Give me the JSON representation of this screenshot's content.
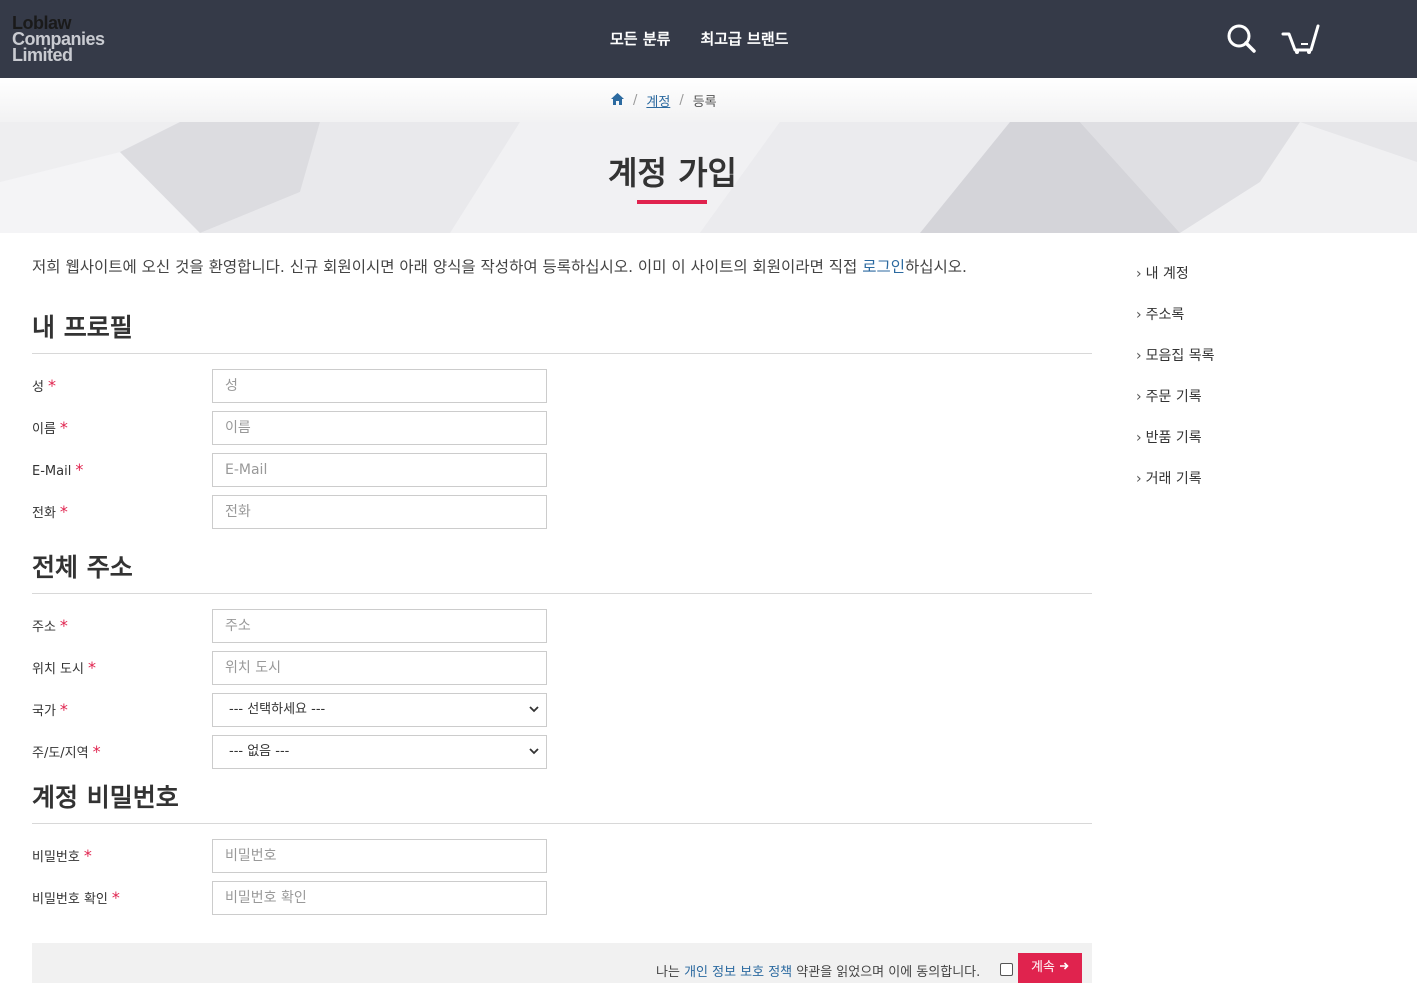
{
  "header": {
    "logo": {
      "line1": "Loblaw",
      "line2": "Companies",
      "line3": "Limited"
    },
    "nav": [
      "모든 분류",
      "최고급 브랜드"
    ]
  },
  "breadcrumb": {
    "account": "계정",
    "current": "등록"
  },
  "banner": {
    "title": "계정 가입"
  },
  "intro": {
    "before": "저희 웹사이트에 오신 것을 환영합니다. 신규 회원이시면 아래 양식을 작성하여 등록하십시오. 이미 이 사이트의 회원이라면 직접 ",
    "link": "로그인",
    "after": "하십시오."
  },
  "profile": {
    "title": "내 프로필",
    "fields": [
      {
        "label": "성",
        "placeholder": "성"
      },
      {
        "label": "이름",
        "placeholder": "이름"
      },
      {
        "label": "E-Mail",
        "placeholder": "E-Mail"
      },
      {
        "label": "전화",
        "placeholder": "전화"
      }
    ]
  },
  "address": {
    "title": "전체 주소",
    "fields": [
      {
        "label": "주소",
        "placeholder": "주소"
      },
      {
        "label": "위치 도시",
        "placeholder": "위치 도시"
      }
    ],
    "country": {
      "label": "국가",
      "selected": "--- 선택하세요 ---"
    },
    "region": {
      "label": "주/도/지역",
      "selected": "--- 없음 ---"
    }
  },
  "password": {
    "title": "계정 비밀번호",
    "fields": [
      {
        "label": "비밀번호",
        "placeholder": "비밀번호"
      },
      {
        "label": "비밀번호 확인",
        "placeholder": "비밀번호 확인"
      }
    ]
  },
  "sidebar": [
    "내 계정",
    "주소록",
    "모음집 목록",
    "주문 기록",
    "반품 기록",
    "거래 기록"
  ],
  "footer": {
    "agree_before": "나는 ",
    "agree_link": "개인 정보 보호 정책",
    "agree_after": " 약관을 읽었으며 이에 동의합니다.",
    "button": "계속"
  },
  "colors": {
    "header_bg": "#353a48",
    "accent": "#e0234e",
    "link": "#2c6aa0"
  }
}
